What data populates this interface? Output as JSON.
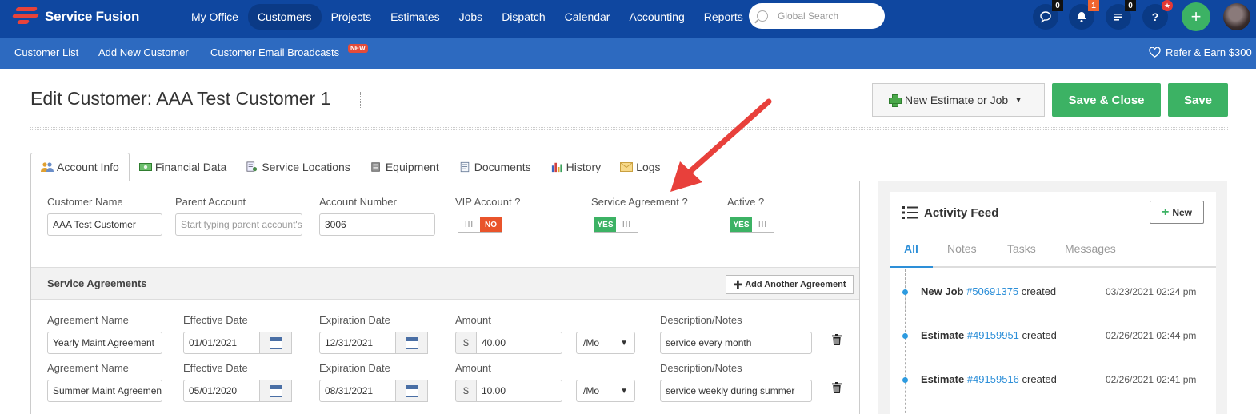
{
  "brand": {
    "name": "Service Fusion"
  },
  "nav": {
    "items": [
      {
        "label": "My Office",
        "active": false
      },
      {
        "label": "Customers",
        "active": true
      },
      {
        "label": "Projects",
        "active": false
      },
      {
        "label": "Estimates",
        "active": false
      },
      {
        "label": "Jobs",
        "active": false
      },
      {
        "label": "Dispatch",
        "active": false
      },
      {
        "label": "Calendar",
        "active": false
      },
      {
        "label": "Accounting",
        "active": false
      },
      {
        "label": "Reports",
        "active": false
      }
    ],
    "search_placeholder": "Global Search",
    "chat_count": "0",
    "bell_count": "1",
    "list_count": "0",
    "help_label": "?",
    "help_badge": "★",
    "plus_label": "+"
  },
  "subnav": {
    "customer_list": "Customer List",
    "add_new_customer": "Add New Customer",
    "email_broadcasts": "Customer Email Broadcasts",
    "new_tag": "NEW",
    "refer": "Refer & Earn $300"
  },
  "page": {
    "title": "Edit Customer: AAA Test Customer 1",
    "new_estimate_label": "New Estimate or Job",
    "save_close_label": "Save & Close",
    "save_label": "Save"
  },
  "tabs": [
    {
      "label": "Account Info",
      "icon": "users-icon",
      "active": true
    },
    {
      "label": "Financial Data",
      "icon": "money-icon",
      "active": false
    },
    {
      "label": "Service Locations",
      "icon": "location-doc-icon",
      "active": false
    },
    {
      "label": "Equipment",
      "icon": "equipment-icon",
      "active": false
    },
    {
      "label": "Documents",
      "icon": "document-icon",
      "active": false
    },
    {
      "label": "History",
      "icon": "chart-icon",
      "active": false
    },
    {
      "label": "Logs",
      "icon": "envelope-icon",
      "active": false
    }
  ],
  "account": {
    "customer_name_label": "Customer Name",
    "customer_name_value": "AAA Test Customer",
    "parent_account_label": "Parent Account",
    "parent_account_placeholder": "Start typing parent account's name",
    "account_number_label": "Account Number",
    "account_number_value": "3006",
    "vip_label": "VIP Account ?",
    "vip_state": "NO",
    "service_agreement_label": "Service Agreement ?",
    "service_agreement_state": "YES",
    "active_label": "Active ?",
    "active_state": "YES",
    "grip": "III"
  },
  "agreements": {
    "section_title": "Service Agreements",
    "add_label": "Add Another Agreement",
    "labels": {
      "name": "Agreement Name",
      "effective": "Effective Date",
      "expiration": "Expiration Date",
      "amount": "Amount",
      "notes": "Description/Notes",
      "currency": "$"
    },
    "rows": [
      {
        "name": "Yearly Maint Agreement",
        "effective": "01/01/2021",
        "expiration": "12/31/2021",
        "amount": "40.00",
        "period": "/Mo",
        "notes": "service every month"
      },
      {
        "name": "Summer Maint Agreement",
        "effective": "05/01/2020",
        "expiration": "08/31/2021",
        "amount": "10.00",
        "period": "/Mo",
        "notes": "service weekly during summer"
      }
    ]
  },
  "feed": {
    "title": "Activity Feed",
    "new_label": "New",
    "tabs": [
      {
        "label": "All",
        "active": true
      },
      {
        "label": "Notes",
        "active": false
      },
      {
        "label": "Tasks",
        "active": false
      },
      {
        "label": "Messages",
        "active": false
      }
    ],
    "items": [
      {
        "type": "New Job",
        "ref": "#50691375",
        "action": "created",
        "date": "03/23/2021 02:24 pm"
      },
      {
        "type": "Estimate",
        "ref": "#49159951",
        "action": "created",
        "date": "02/26/2021 02:44 pm"
      },
      {
        "type": "Estimate",
        "ref": "#49159516",
        "action": "created",
        "date": "02/26/2021 02:41 pm"
      }
    ]
  },
  "colors": {
    "nav_bg": "#0f47a0",
    "subnav_bg": "#2d6ac0",
    "green": "#3cb264",
    "red_no": "#e9542b",
    "link": "#2d8fd8",
    "annotation_arrow": "#e8403b"
  }
}
